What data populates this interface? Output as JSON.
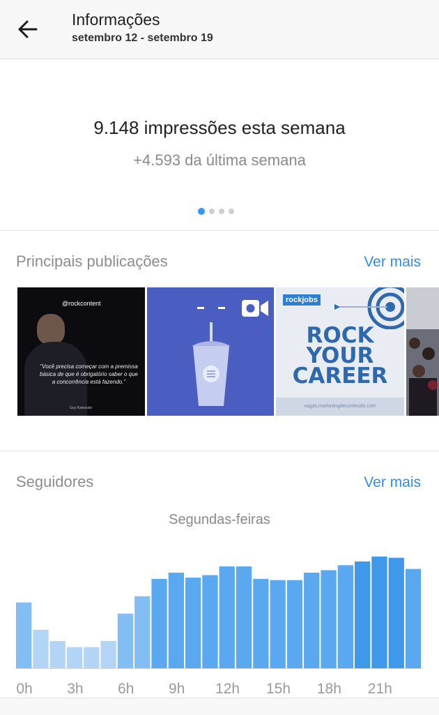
{
  "header": {
    "title": "Informações",
    "date_range": "setembro 12 - setembro 19",
    "back_icon": "arrow-left-icon"
  },
  "impressions": {
    "main": "9.148 impressões esta semana",
    "delta": "+4.593 da última semana",
    "carousel_pages": 4,
    "carousel_active": 1
  },
  "top_posts": {
    "title": "Principais publicações",
    "see_more": "Ver mais",
    "posts": [
      {
        "brand": "@rockcontent",
        "quote": "\"Você precisa começar com a premissa básica de que é obrigatório saber o que a concorrência está fazendo.\"",
        "author": "Guy Kawasaki"
      },
      {
        "icon": "video-camera-icon"
      },
      {
        "logo": "rockjobs",
        "headline": "ROCK YOUR CAREER",
        "url": "vagas.marketingdeconteudo.com"
      },
      {}
    ]
  },
  "followers": {
    "title": "Seguidores",
    "see_more": "Ver mais",
    "chart_label": "Segundas-feiras"
  },
  "chart_data": {
    "type": "bar",
    "categories": [
      "0h",
      "1h",
      "2h",
      "3h",
      "4h",
      "5h",
      "6h",
      "7h",
      "8h",
      "9h",
      "10h",
      "11h",
      "12h",
      "13h",
      "14h",
      "15h",
      "16h",
      "17h",
      "18h",
      "19h",
      "20h",
      "21h",
      "22h",
      "23h"
    ],
    "values": [
      53,
      31,
      22,
      17,
      17,
      22,
      44,
      58,
      72,
      77,
      73,
      75,
      82,
      82,
      72,
      71,
      71,
      77,
      79,
      83,
      86,
      90,
      89,
      80
    ],
    "tick_labels": [
      "0h",
      "3h",
      "6h",
      "9h",
      "12h",
      "15h",
      "18h",
      "21h"
    ],
    "ylim": [
      0,
      100
    ],
    "colors": {
      "low": "#b2d5f6",
      "mid": "#82bdf3",
      "high": "#5aa8ef",
      "top": "#3f98ea"
    }
  }
}
